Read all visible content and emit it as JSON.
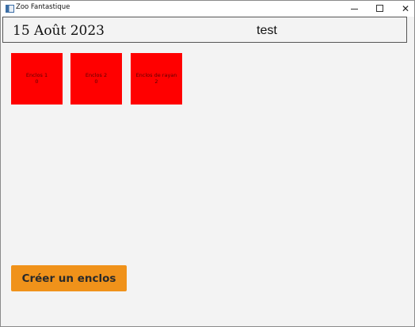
{
  "window": {
    "title": "Zoo Fantastique",
    "controls": {
      "minimize_icon": "minimize-icon",
      "maximize_icon": "maximize-icon",
      "close_glyph": "✕"
    }
  },
  "header": {
    "date": "15 Août 2023",
    "user": "test"
  },
  "enclos": [
    {
      "name": "Enclos 1",
      "count": "0"
    },
    {
      "name": "Enclos 2",
      "count": "0"
    },
    {
      "name": "Enclos de rayan",
      "count": "2"
    }
  ],
  "actions": {
    "create_label": "Créer un enclos"
  },
  "colors": {
    "enclos_card": "#ff0000",
    "create_button": "#f0921a",
    "background": "#f3f3f3"
  }
}
